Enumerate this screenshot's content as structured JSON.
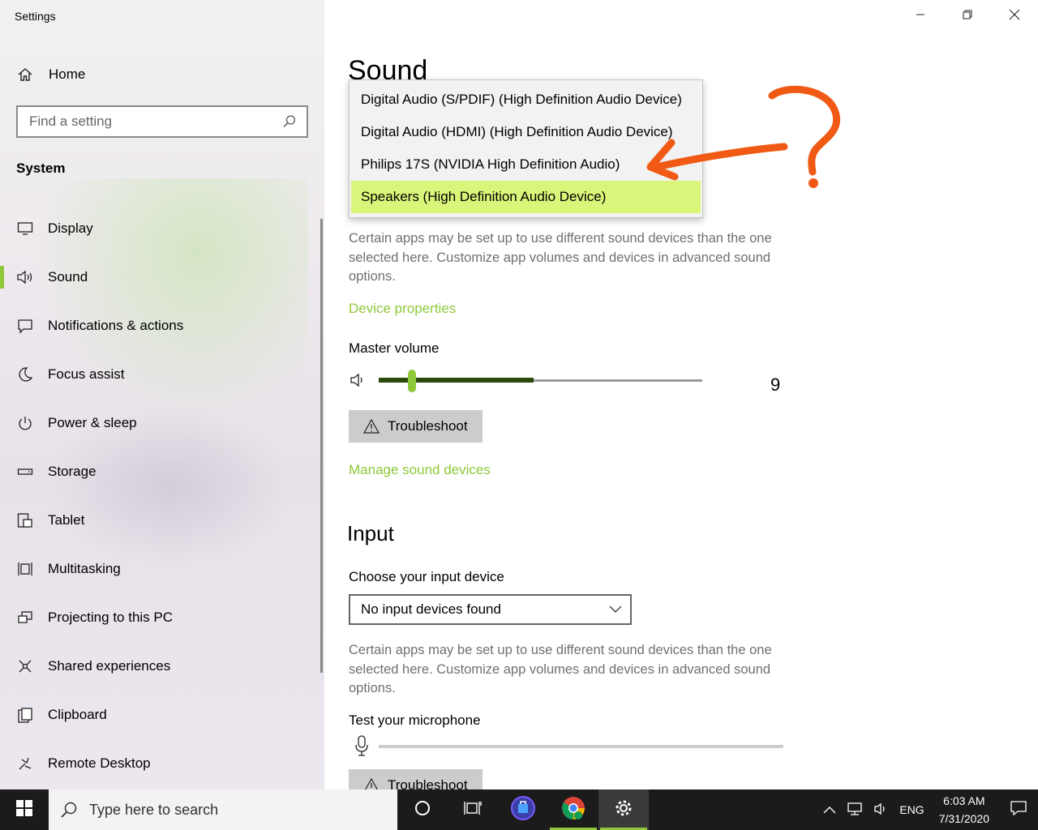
{
  "window": {
    "app_title": "Settings",
    "controls": [
      "minimize-icon",
      "restore-icon",
      "close-icon"
    ]
  },
  "sidebar": {
    "home_label": "Home",
    "search_placeholder": "Find a setting",
    "section_title": "System",
    "items": [
      {
        "label": "Display",
        "icon": "display-icon"
      },
      {
        "label": "Sound",
        "icon": "speaker-icon",
        "active": true
      },
      {
        "label": "Notifications & actions",
        "icon": "notification-icon"
      },
      {
        "label": "Focus assist",
        "icon": "moon-icon"
      },
      {
        "label": "Power & sleep",
        "icon": "power-icon"
      },
      {
        "label": "Storage",
        "icon": "storage-icon"
      },
      {
        "label": "Tablet",
        "icon": "tablet-icon"
      },
      {
        "label": "Multitasking",
        "icon": "multitasking-icon"
      },
      {
        "label": "Projecting to this PC",
        "icon": "projecting-icon"
      },
      {
        "label": "Shared experiences",
        "icon": "shared-icon"
      },
      {
        "label": "Clipboard",
        "icon": "clipboard-icon"
      },
      {
        "label": "Remote Desktop",
        "icon": "remote-desktop-icon"
      }
    ]
  },
  "main": {
    "title": "Sound",
    "output_dropdown": {
      "options": [
        "Digital Audio (S/PDIF) (High Definition Audio Device)",
        "Digital Audio (HDMI) (High Definition Audio Device)",
        "Philips 17S (NVIDIA High Definition Audio)",
        "Speakers (High Definition Audio Device)"
      ],
      "selected_index": 3
    },
    "output_description": "Certain apps may be set up to use different sound devices than the one selected here. Customize app volumes and devices in advanced sound options.",
    "device_properties_link": "Device properties",
    "master_volume_label": "Master volume",
    "master_volume_value": "9",
    "master_volume_level": 0.09,
    "troubleshoot_label": "Troubleshoot",
    "manage_devices_link": "Manage sound devices",
    "input_heading": "Input",
    "input_device_label": "Choose your input device",
    "input_device_value": "No input devices found",
    "input_description": "Certain apps may be set up to use different sound devices than the one selected here. Customize app volumes and devices in advanced sound options.",
    "test_mic_label": "Test your microphone",
    "troubleshoot2_label": "Troubleshoot"
  },
  "annotation": {
    "symbol": "?",
    "color": "#f05a14"
  },
  "taskbar": {
    "search_placeholder": "Type here to search",
    "language": "ENG",
    "time": "6:03 AM",
    "date": "7/31/2020"
  },
  "colors": {
    "accent": "#8fc93a",
    "highlight": "#d9f57a",
    "taskbar": "#1b1b1b"
  }
}
